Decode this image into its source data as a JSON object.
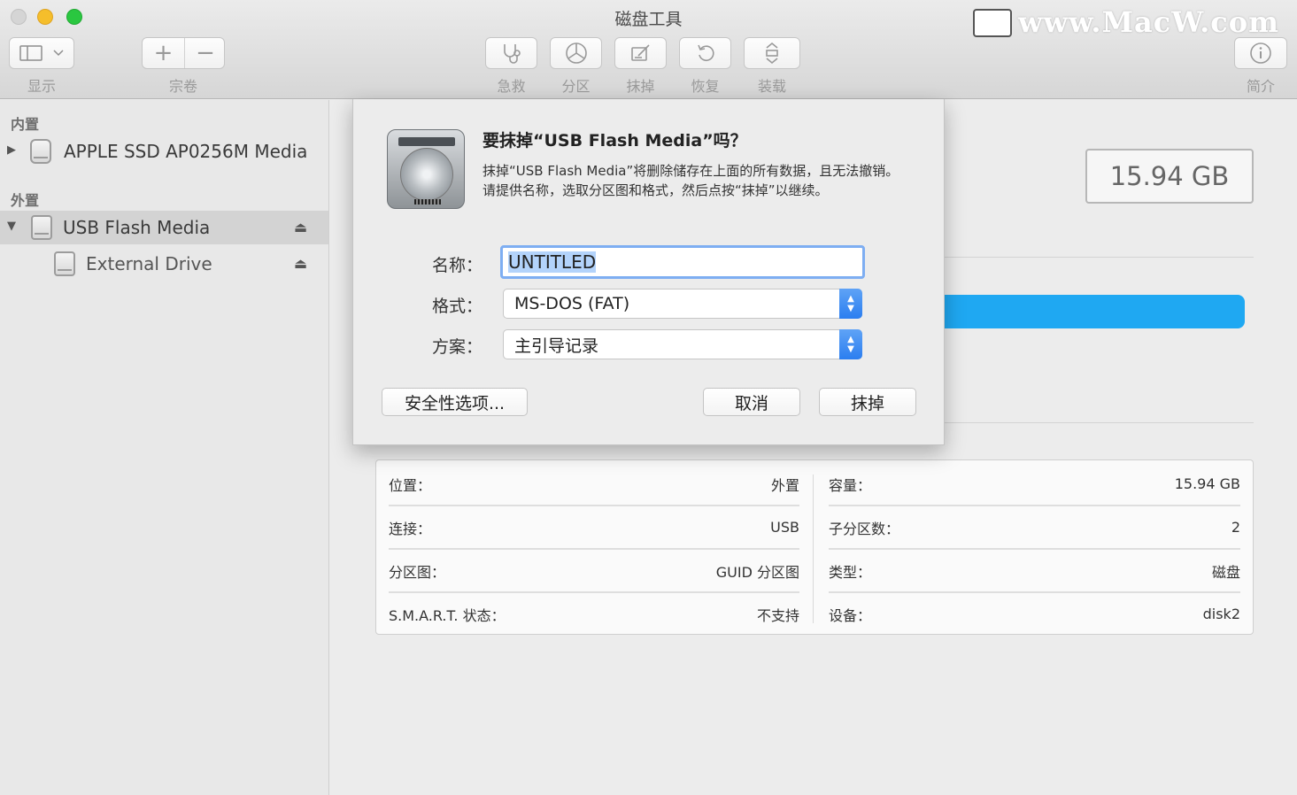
{
  "window": {
    "title": "磁盘工具"
  },
  "watermark": {
    "text": "www.MacW.com"
  },
  "toolbar": {
    "view_label": "显示",
    "volume_label": "宗卷",
    "first_aid_label": "急救",
    "partition_label": "分区",
    "erase_label": "抹掉",
    "restore_label": "恢复",
    "mount_label": "装载",
    "info_label": "简介"
  },
  "sidebar": {
    "internal_header": "内置",
    "external_header": "外置",
    "items": [
      {
        "label": "APPLE SSD AP0256M Media"
      },
      {
        "label": "USB Flash Media"
      },
      {
        "label": "External Drive"
      }
    ]
  },
  "main": {
    "capacity": "15.94 GB",
    "usage_color": "#1fa8f2",
    "info": {
      "left": [
        {
          "key": "位置：",
          "value": "外置"
        },
        {
          "key": "连接：",
          "value": "USB"
        },
        {
          "key": "分区图：",
          "value": "GUID 分区图"
        },
        {
          "key": "S.M.A.R.T. 状态：",
          "value": "不支持"
        }
      ],
      "right": [
        {
          "key": "容量：",
          "value": "15.94 GB"
        },
        {
          "key": "子分区数：",
          "value": "2"
        },
        {
          "key": "类型：",
          "value": "磁盘"
        },
        {
          "key": "设备：",
          "value": "disk2"
        }
      ]
    }
  },
  "dialog": {
    "title": "要抹掉“USB Flash Media”吗？",
    "message": "抹掉“USB Flash Media”将删除储存在上面的所有数据，且无法撤销。请提供名称，选取分区图和格式，然后点按“抹掉”以继续。",
    "name_label": "名称：",
    "name_value": "UNTITLED",
    "format_label": "格式：",
    "format_value": "MS-DOS (FAT)",
    "scheme_label": "方案：",
    "scheme_value": "主引导记录",
    "security_button": "安全性选项...",
    "cancel_button": "取消",
    "erase_button": "抹掉"
  }
}
